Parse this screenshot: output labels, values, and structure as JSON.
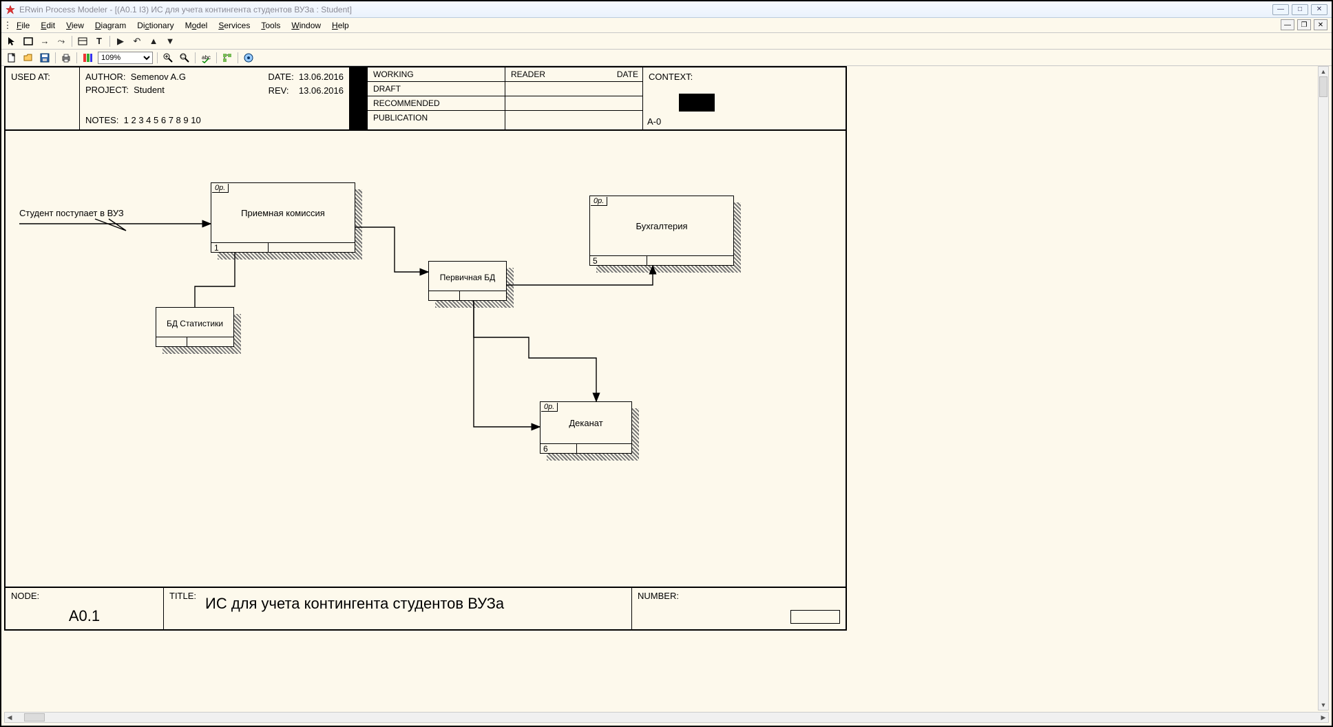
{
  "window": {
    "title": "ERwin Process Modeler - [(A0.1 I3) ИС для учета контингента студентов ВУЗа : Student]"
  },
  "menu": {
    "file": "File",
    "edit": "Edit",
    "view": "View",
    "diagram": "Diagram",
    "dictionary": "Dictionary",
    "model": "Model",
    "services": "Services",
    "tools": "Tools",
    "window": "Window",
    "help": "Help"
  },
  "toolbar": {
    "zoom": "109%"
  },
  "sheet": {
    "header": {
      "usedat_label": "USED AT:",
      "author_label": "AUTHOR:",
      "author": "Semenov A.G",
      "project_label": "PROJECT:",
      "project": "Student",
      "date_label": "DATE:",
      "date": "13.06.2016",
      "rev_label": "REV:",
      "rev": "13.06.2016",
      "notes_label": "NOTES:",
      "notes": "1  2  3  4  5  6  7  8  9  10",
      "status": {
        "working": "WORKING",
        "draft": "DRAFT",
        "recommended": "RECOMMENDED",
        "publication": "PUBLICATION"
      },
      "reader_label": "READER",
      "reader_date": "DATE",
      "context_label": "CONTEXT:",
      "context_node": "A-0"
    },
    "footer": {
      "node_label": "NODE:",
      "node": "A0.1",
      "title_label": "TITLE:",
      "title": "ИС для учета контингента студентов ВУЗа",
      "number_label": "NUMBER:"
    }
  },
  "diagram": {
    "input_arrow": "Студент поступает в ВУЗ",
    "box1": {
      "tag": "0р.",
      "label": "Приемная комиссия",
      "num": "1"
    },
    "box_bd_stat": {
      "label": "БД Статистики"
    },
    "box_bd_prim": {
      "label": "Первичная БД"
    },
    "box5": {
      "tag": "0р.",
      "label": "Бухгалтерия",
      "num": "5"
    },
    "box6": {
      "tag": "0р.",
      "label": "Деканат",
      "num": "6"
    }
  }
}
